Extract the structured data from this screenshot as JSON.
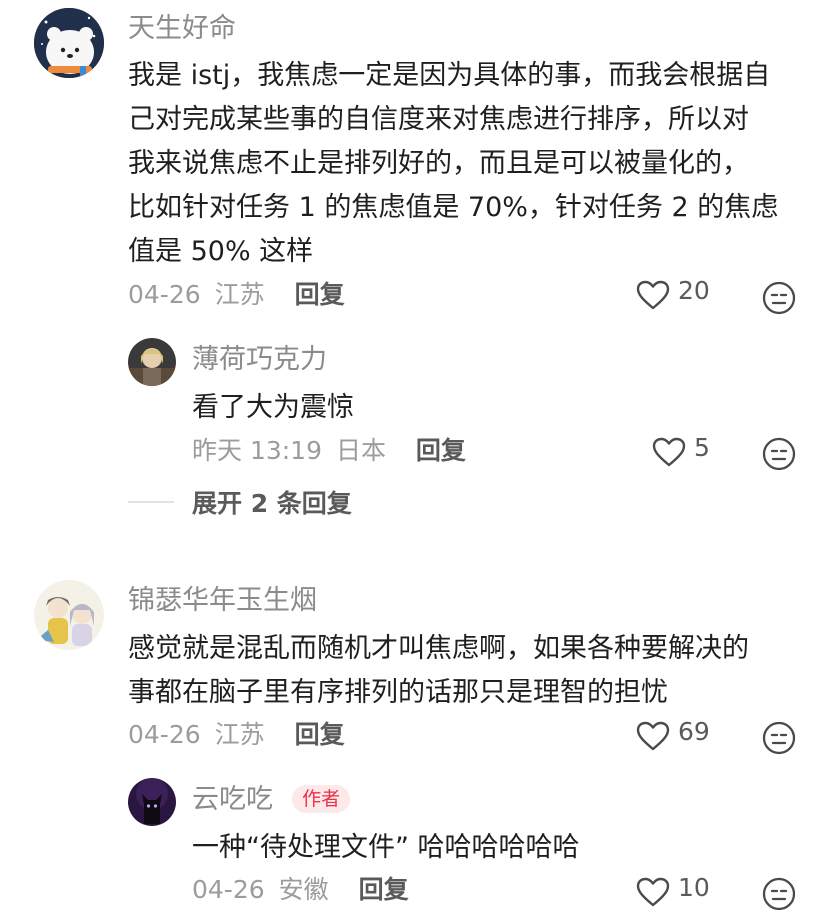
{
  "comments": [
    {
      "username": "天生好命",
      "lines": [
        "我是 istj，我焦虑一定是因为具体的事，而我会根据自",
        "己对完成某些事的自信度来对焦虑进行排序，所以对",
        "我来说焦虑不止是排列好的，而且是可以被量化的，",
        "比如针对任务 1 的焦虑值是 70%，针对任务 2 的焦虑",
        "值是 50% 这样"
      ],
      "date": "04-26",
      "location": "江苏",
      "reply_label": "回复",
      "likes": "20",
      "replies": [
        {
          "username": "薄荷巧克力",
          "text": "看了大为震惊",
          "date": "昨天 13:19",
          "location": "日本",
          "reply_label": "回复",
          "likes": "5"
        }
      ],
      "expand_label": "展开 2 条回复"
    },
    {
      "username": "锦瑟华年玉生烟",
      "lines": [
        "感觉就是混乱而随机才叫焦虑啊，如果各种要解决的",
        "事都在脑子里有序排列的话那只是理智的担忧"
      ],
      "date": "04-26",
      "location": "江苏",
      "reply_label": "回复",
      "likes": "69",
      "replies": [
        {
          "username": "云吃吃",
          "badge": "作者",
          "text": "一种“待处理文件” 哈哈哈哈哈哈",
          "date": "04-26",
          "location": "安徽",
          "reply_label": "回复",
          "likes": "10"
        }
      ]
    }
  ],
  "icons": {
    "like": "heart-outline-icon",
    "dislike": "unamused-face-icon"
  }
}
